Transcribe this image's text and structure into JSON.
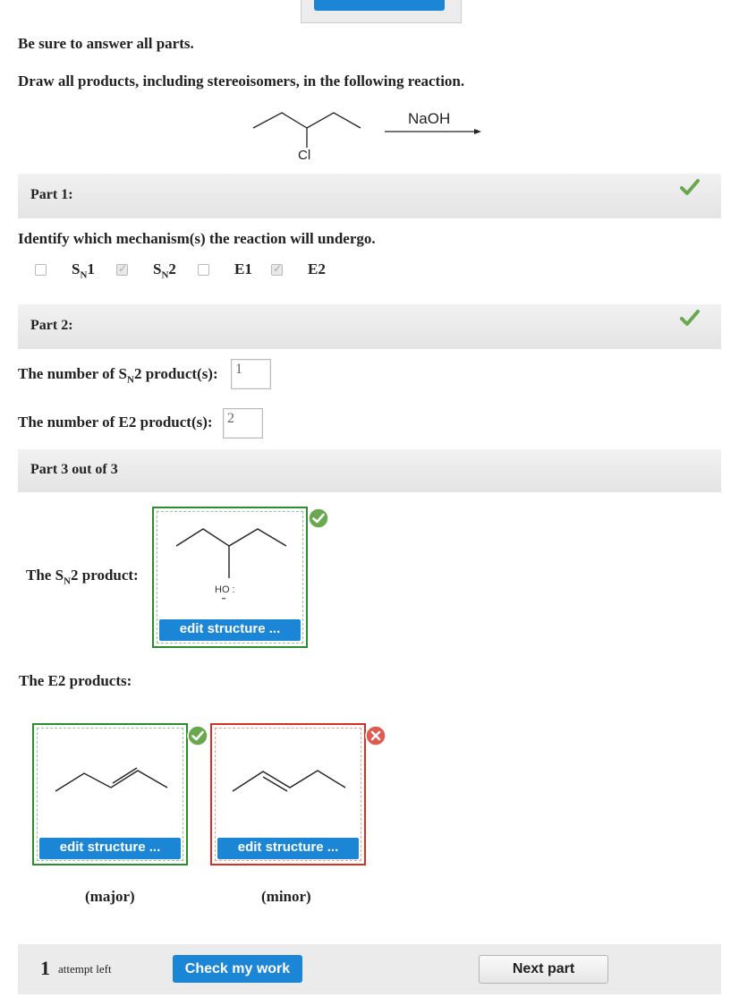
{
  "instructions": {
    "line1": "Be sure to answer all parts.",
    "line2": "Draw all products, including stereoisomers, in the following reaction."
  },
  "reaction": {
    "reagent": "NaOH",
    "substituent": "Cl"
  },
  "part1": {
    "title": "Part 1:",
    "question": "Identify which mechanism(s) the reaction will undergo.",
    "options": [
      {
        "main": "S",
        "sub": "N",
        "suffix": "1",
        "checked": false
      },
      {
        "main": "S",
        "sub": "N",
        "suffix": "2",
        "checked": true
      },
      {
        "main": "E1",
        "sub": "",
        "suffix": "",
        "checked": false
      },
      {
        "main": "E2",
        "sub": "",
        "suffix": "",
        "checked": true
      }
    ],
    "status": "correct"
  },
  "part2": {
    "title": "Part 2:",
    "sn2_label_pre": "The number of S",
    "sn2_label_sub": "N",
    "sn2_label_post": "2 product(s):",
    "sn2_value": "1",
    "e2_label": "The number of E2 product(s):",
    "e2_value": "2",
    "status": "correct"
  },
  "part3": {
    "title": "Part 3 out of 3",
    "sn2_product_pre": "The S",
    "sn2_product_sub": "N",
    "sn2_product_post": "2 product:",
    "oh_label": "HO :",
    "oh_dots": "••",
    "e2_products_label": "The E2 products:",
    "edit_label": "edit structure ...",
    "major_label": "(major)",
    "minor_label": "(minor)"
  },
  "footer": {
    "attempts_count": "1",
    "attempts_text": "attempt left",
    "check_button": "Check my work",
    "next_button": "Next part"
  },
  "colors": {
    "correct": "#6aa84f",
    "incorrect": "#e05a4f",
    "accent": "#1b85d6"
  }
}
